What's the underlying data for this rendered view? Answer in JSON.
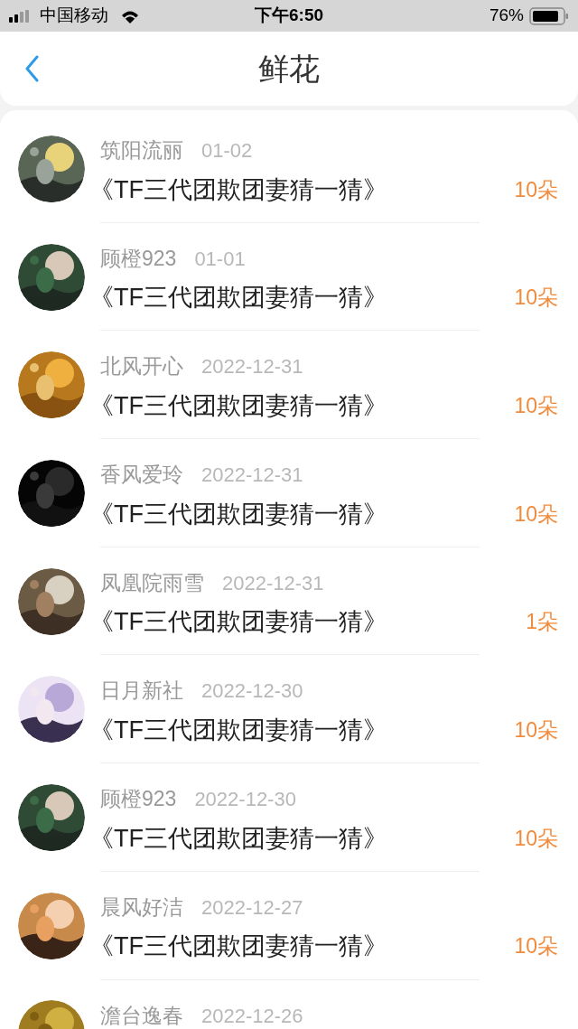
{
  "status_bar": {
    "carrier": "中国移动",
    "time": "下午6:50",
    "battery": "76%"
  },
  "header": {
    "title": "鲜花"
  },
  "rows": [
    {
      "name": "筑阳流丽",
      "date": "01-02",
      "title": "《TF三代团欺团妻猜一猜》",
      "amount": "10朵"
    },
    {
      "name": "顾橙923",
      "date": "01-01",
      "title": "《TF三代团欺团妻猜一猜》",
      "amount": "10朵"
    },
    {
      "name": "北风开心",
      "date": "2022-12-31",
      "title": "《TF三代团欺团妻猜一猜》",
      "amount": "10朵"
    },
    {
      "name": "香风爱玲",
      "date": "2022-12-31",
      "title": "《TF三代团欺团妻猜一猜》",
      "amount": "10朵"
    },
    {
      "name": "凤凰院雨雪",
      "date": "2022-12-31",
      "title": "《TF三代团欺团妻猜一猜》",
      "amount": "1朵"
    },
    {
      "name": "日月新社",
      "date": "2022-12-30",
      "title": "《TF三代团欺团妻猜一猜》",
      "amount": "10朵"
    },
    {
      "name": "顾橙923",
      "date": "2022-12-30",
      "title": "《TF三代团欺团妻猜一猜》",
      "amount": "10朵"
    },
    {
      "name": "晨风好洁",
      "date": "2022-12-27",
      "title": "《TF三代团欺团妻猜一猜》",
      "amount": "10朵"
    },
    {
      "name": "澹台逸春",
      "date": "2022-12-26"
    }
  ]
}
